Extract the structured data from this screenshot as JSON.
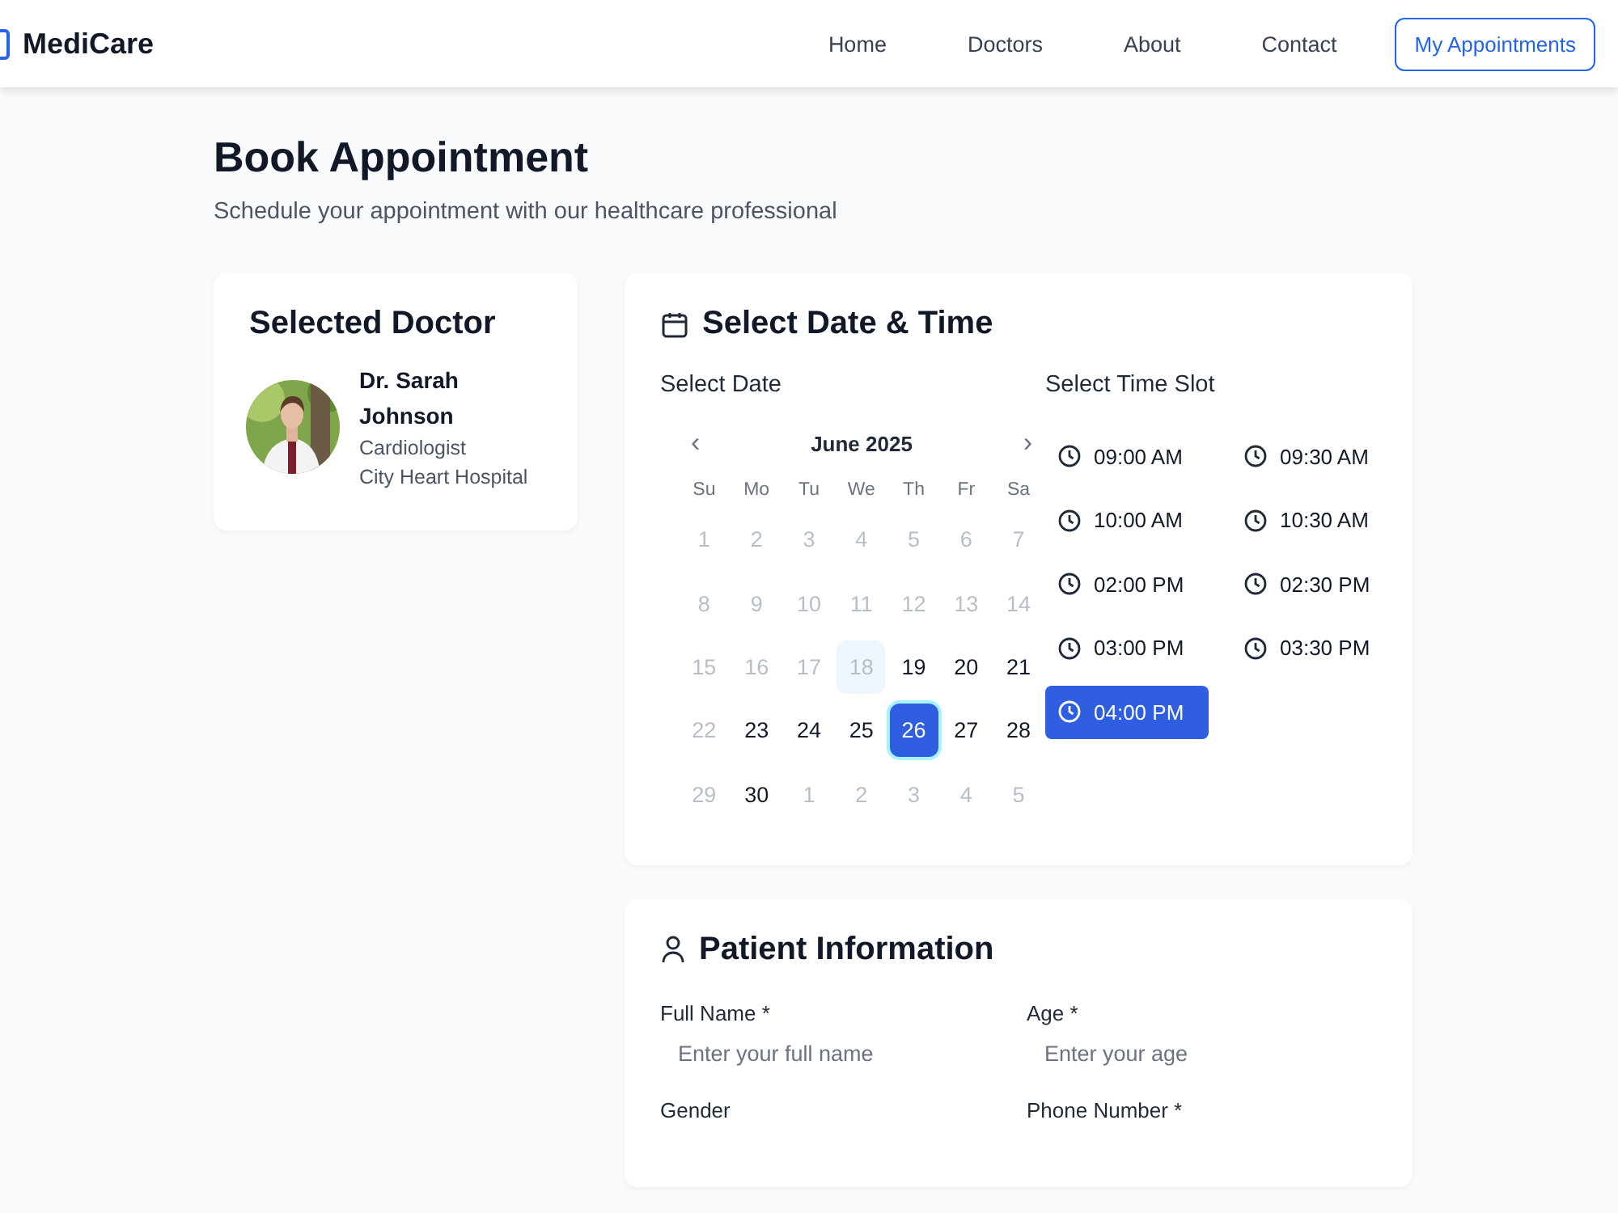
{
  "brand": "MediCare",
  "nav": [
    {
      "label": "Home"
    },
    {
      "label": "Doctors"
    },
    {
      "label": "About"
    },
    {
      "label": "Contact"
    }
  ],
  "nav_button": "My Appointments",
  "page": {
    "title": "Book Appointment",
    "subtitle": "Schedule your appointment with our healthcare professional"
  },
  "doctor_card": {
    "title": "Selected Doctor",
    "name": "Dr. Sarah Johnson",
    "specialty": "Cardiologist",
    "hospital": "City Heart Hospital"
  },
  "schedule": {
    "title": "Select Date & Time",
    "date_label": "Select Date",
    "time_label": "Select Time Slot",
    "calendar": {
      "prev": "‹",
      "month": "June 2025",
      "next": "›",
      "weekdays": [
        "Su",
        "Mo",
        "Tu",
        "We",
        "Th",
        "Fr",
        "Sa"
      ],
      "weeks": [
        [
          {
            "day": "1",
            "disabled": true,
            "selected": false,
            "today": false
          },
          {
            "day": "2",
            "disabled": true,
            "selected": false,
            "today": false
          },
          {
            "day": "3",
            "disabled": true,
            "selected": false,
            "today": false
          },
          {
            "day": "4",
            "disabled": true,
            "selected": false,
            "today": false
          },
          {
            "day": "5",
            "disabled": true,
            "selected": false,
            "today": false
          },
          {
            "day": "6",
            "disabled": true,
            "selected": false,
            "today": false
          },
          {
            "day": "7",
            "disabled": true,
            "selected": false,
            "today": false
          }
        ],
        [
          {
            "day": "8",
            "disabled": true,
            "selected": false,
            "today": false
          },
          {
            "day": "9",
            "disabled": true,
            "selected": false,
            "today": false
          },
          {
            "day": "10",
            "disabled": true,
            "selected": false,
            "today": false
          },
          {
            "day": "11",
            "disabled": true,
            "selected": false,
            "today": false
          },
          {
            "day": "12",
            "disabled": true,
            "selected": false,
            "today": false
          },
          {
            "day": "13",
            "disabled": true,
            "selected": false,
            "today": false
          },
          {
            "day": "14",
            "disabled": true,
            "selected": false,
            "today": false
          }
        ],
        [
          {
            "day": "15",
            "disabled": true,
            "selected": false,
            "today": false
          },
          {
            "day": "16",
            "disabled": true,
            "selected": false,
            "today": false
          },
          {
            "day": "17",
            "disabled": true,
            "selected": false,
            "today": false
          },
          {
            "day": "18",
            "disabled": true,
            "selected": false,
            "today": true
          },
          {
            "day": "19",
            "disabled": false,
            "selected": false,
            "today": false
          },
          {
            "day": "20",
            "disabled": false,
            "selected": false,
            "today": false
          },
          {
            "day": "21",
            "disabled": false,
            "selected": false,
            "today": false
          }
        ],
        [
          {
            "day": "22",
            "disabled": true,
            "selected": false,
            "today": false
          },
          {
            "day": "23",
            "disabled": false,
            "selected": false,
            "today": false
          },
          {
            "day": "24",
            "disabled": false,
            "selected": false,
            "today": false
          },
          {
            "day": "25",
            "disabled": false,
            "selected": false,
            "today": false
          },
          {
            "day": "26",
            "disabled": false,
            "selected": true,
            "today": false
          },
          {
            "day": "27",
            "disabled": false,
            "selected": false,
            "today": false
          },
          {
            "day": "28",
            "disabled": false,
            "selected": false,
            "today": false
          }
        ],
        [
          {
            "day": "29",
            "disabled": true,
            "selected": false,
            "today": false
          },
          {
            "day": "30",
            "disabled": false,
            "selected": false,
            "today": false
          },
          {
            "day": "1",
            "disabled": true,
            "selected": false,
            "today": false
          },
          {
            "day": "2",
            "disabled": true,
            "selected": false,
            "today": false
          },
          {
            "day": "3",
            "disabled": true,
            "selected": false,
            "today": false
          },
          {
            "day": "4",
            "disabled": true,
            "selected": false,
            "today": false
          },
          {
            "day": "5",
            "disabled": true,
            "selected": false,
            "today": false
          }
        ]
      ]
    },
    "slots": [
      {
        "label": "09:00 AM",
        "selected": false
      },
      {
        "label": "09:30 AM",
        "selected": false
      },
      {
        "label": "10:00 AM",
        "selected": false
      },
      {
        "label": "10:30 AM",
        "selected": false
      },
      {
        "label": "02:00 PM",
        "selected": false
      },
      {
        "label": "02:30 PM",
        "selected": false
      },
      {
        "label": "03:00 PM",
        "selected": false
      },
      {
        "label": "03:30 PM",
        "selected": false
      },
      {
        "label": "04:00 PM",
        "selected": true
      }
    ]
  },
  "patient": {
    "title": "Patient Information",
    "fields": [
      {
        "label": "Full Name *",
        "placeholder": "Enter your full name"
      },
      {
        "label": "Age *",
        "placeholder": "Enter your age"
      },
      {
        "label": "Gender"
      },
      {
        "label": "Phone Number *"
      }
    ]
  }
}
